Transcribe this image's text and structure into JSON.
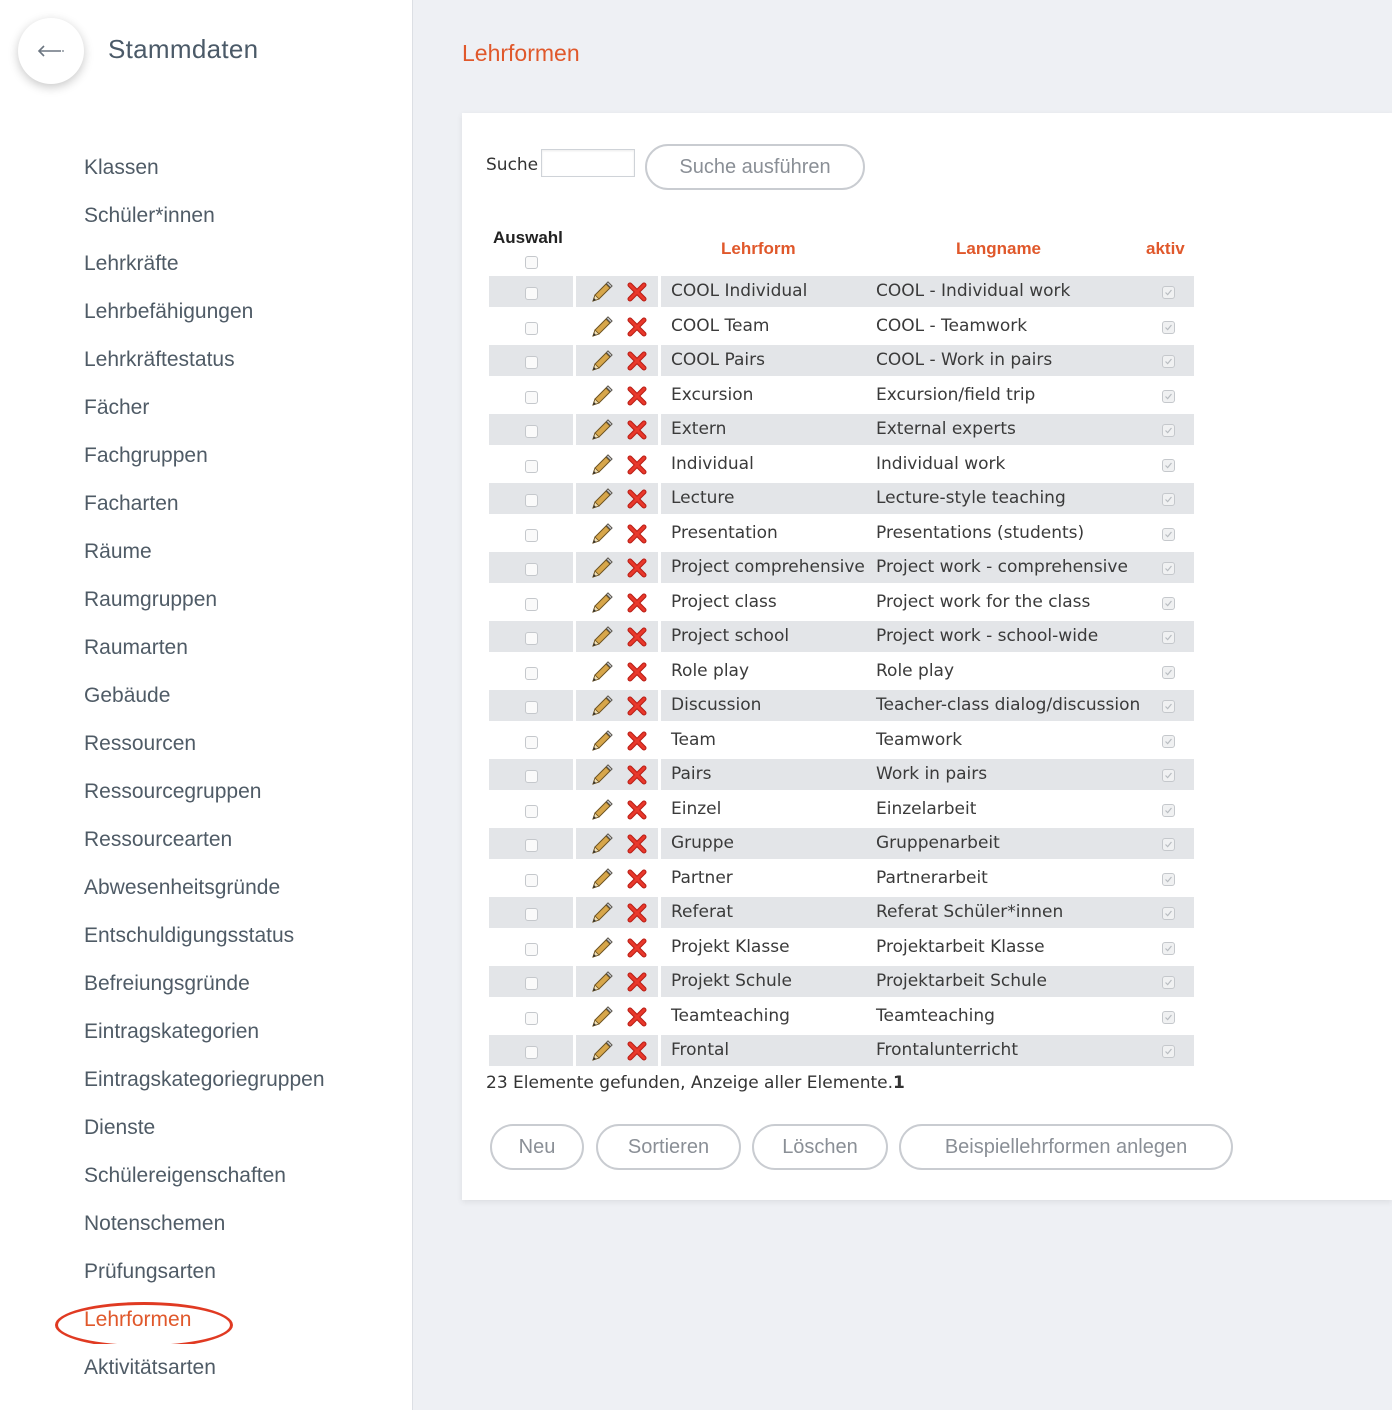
{
  "sidebar": {
    "title": "Stammdaten",
    "back_icon": "arrow-left-icon",
    "items": [
      {
        "label": "Klassen"
      },
      {
        "label": "Schüler*innen"
      },
      {
        "label": "Lehrkräfte"
      },
      {
        "label": "Lehrbefähigungen"
      },
      {
        "label": "Lehrkräftestatus"
      },
      {
        "label": "Fächer"
      },
      {
        "label": "Fachgruppen"
      },
      {
        "label": "Facharten"
      },
      {
        "label": "Räume"
      },
      {
        "label": "Raumgruppen"
      },
      {
        "label": "Raumarten"
      },
      {
        "label": "Gebäude"
      },
      {
        "label": "Ressourcen"
      },
      {
        "label": "Ressourcegruppen"
      },
      {
        "label": "Ressourcearten"
      },
      {
        "label": "Abwesenheitsgründe"
      },
      {
        "label": "Entschuldigungsstatus"
      },
      {
        "label": "Befreiungsgründe"
      },
      {
        "label": "Eintragskategorien"
      },
      {
        "label": "Eintragskategoriegruppen"
      },
      {
        "label": "Dienste"
      },
      {
        "label": "Schülereigenschaften"
      },
      {
        "label": "Notenschemen"
      },
      {
        "label": "Prüfungsarten"
      },
      {
        "label": "Lehrformen"
      },
      {
        "label": "Aktivitätsarten"
      }
    ],
    "active_item": "Lehrformen"
  },
  "main": {
    "title": "Lehrformen",
    "search": {
      "label": "Suche",
      "value": "",
      "button": "Suche ausführen"
    },
    "table": {
      "headers": {
        "select": "Auswahl",
        "lehrform": "Lehrform",
        "langname": "Langname",
        "aktiv": "aktiv"
      },
      "rows": [
        {
          "lehrform": "COOL Individual",
          "langname": "COOL - Individual work",
          "aktiv": true
        },
        {
          "lehrform": "COOL Team",
          "langname": "COOL - Teamwork",
          "aktiv": true
        },
        {
          "lehrform": "COOL Pairs",
          "langname": "COOL - Work in pairs",
          "aktiv": true
        },
        {
          "lehrform": "Excursion",
          "langname": "Excursion/field trip",
          "aktiv": true
        },
        {
          "lehrform": "Extern",
          "langname": "External experts",
          "aktiv": true
        },
        {
          "lehrform": "Individual",
          "langname": "Individual work",
          "aktiv": true
        },
        {
          "lehrform": "Lecture",
          "langname": "Lecture-style teaching",
          "aktiv": true
        },
        {
          "lehrform": "Presentation",
          "langname": "Presentations (students)",
          "aktiv": true
        },
        {
          "lehrform": "Project comprehensive",
          "langname": "Project work - comprehensive",
          "aktiv": true
        },
        {
          "lehrform": "Project class",
          "langname": "Project work for the class",
          "aktiv": true
        },
        {
          "lehrform": "Project school",
          "langname": "Project work - school-wide",
          "aktiv": true
        },
        {
          "lehrform": "Role play",
          "langname": "Role play",
          "aktiv": true
        },
        {
          "lehrform": "Discussion",
          "langname": "Teacher-class dialog/discussion",
          "aktiv": true
        },
        {
          "lehrform": "Team",
          "langname": "Teamwork",
          "aktiv": true
        },
        {
          "lehrform": "Pairs",
          "langname": "Work in pairs",
          "aktiv": true
        },
        {
          "lehrform": "Einzel",
          "langname": "Einzelarbeit",
          "aktiv": true
        },
        {
          "lehrform": "Gruppe",
          "langname": "Gruppenarbeit",
          "aktiv": true
        },
        {
          "lehrform": "Partner",
          "langname": "Partnerarbeit",
          "aktiv": true
        },
        {
          "lehrform": "Referat",
          "langname": "Referat Schüler*innen",
          "aktiv": true
        },
        {
          "lehrform": "Projekt Klasse",
          "langname": "Projektarbeit Klasse",
          "aktiv": true
        },
        {
          "lehrform": "Projekt Schule",
          "langname": "Projektarbeit Schule",
          "aktiv": true
        },
        {
          "lehrform": "Teamteaching",
          "langname": "Teamteaching",
          "aktiv": true
        },
        {
          "lehrform": "Frontal",
          "langname": "Frontalunterricht",
          "aktiv": true
        }
      ]
    },
    "summary": {
      "text": "23 Elemente gefunden, Anzeige aller Elemente.",
      "page": "1"
    },
    "buttons": {
      "neu": "Neu",
      "sortieren": "Sortieren",
      "loeschen": "Löschen",
      "beispiel": "Beispiellehrformen anlegen"
    },
    "icons": {
      "edit": "pencil-icon",
      "delete": "delete-x-icon",
      "checkbox": "checkbox-icon"
    },
    "colors": {
      "accent": "#e0582b",
      "highlight_ring": "#e03a22",
      "row_shade": "#e3e5e8",
      "delete_red": "#d6261c"
    }
  }
}
